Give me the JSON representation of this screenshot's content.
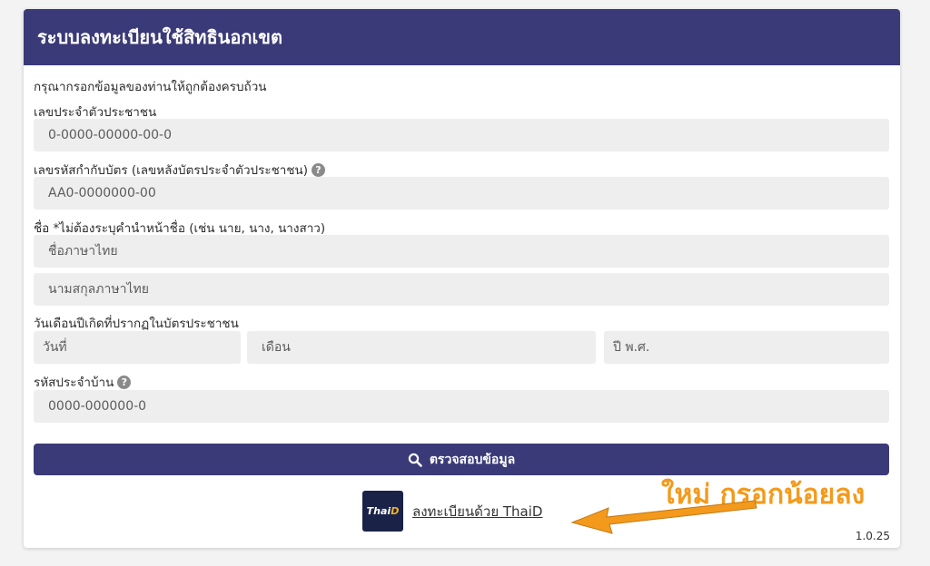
{
  "header": {
    "title": "ระบบลงทะเบียนใช้สิทธินอกเขต"
  },
  "form": {
    "intro": "กรุณากรอกข้อมูลของท่านให้ถูกต้องครบถ้วน",
    "citizen_id": {
      "label": "เลขประจำตัวประชาชน",
      "placeholder": "0-0000-00000-00-0"
    },
    "laser_code": {
      "label": "เลขรหัสกำกับบัตร (เลขหลังบัตรประจำตัวประชาชน)",
      "help": "?",
      "placeholder": "AA0-0000000-00"
    },
    "name": {
      "label": "ชื่อ *ไม่ต้องระบุคำนำหน้าชื่อ (เช่น นาย, นาง, นางสาว)",
      "first_placeholder": "ชื่อภาษาไทย",
      "last_placeholder": "นามสกุลภาษาไทย"
    },
    "birthdate": {
      "label": "วันเดือนปีเกิดที่ปรากฏในบัตรประชาชน",
      "day_placeholder": "วันที่",
      "month_placeholder": "เดือน",
      "year_placeholder": "ปี พ.ศ."
    },
    "house_code": {
      "label": "รหัสประจำบ้าน",
      "help": "?",
      "placeholder": "0000-000000-0"
    },
    "submit_label": "ตรวจสอบข้อมูล"
  },
  "thaid": {
    "logo_text_a": "Thai",
    "logo_text_b": "D",
    "link": "ลงทะเบียนด้วย ThaiD"
  },
  "version": "1.0.25",
  "annotation": "ใหม่ กรอกน้อยลง",
  "colors": {
    "primary": "#3b3a78",
    "input_bg": "#eeeeee",
    "annotation": "#f39a1c"
  }
}
